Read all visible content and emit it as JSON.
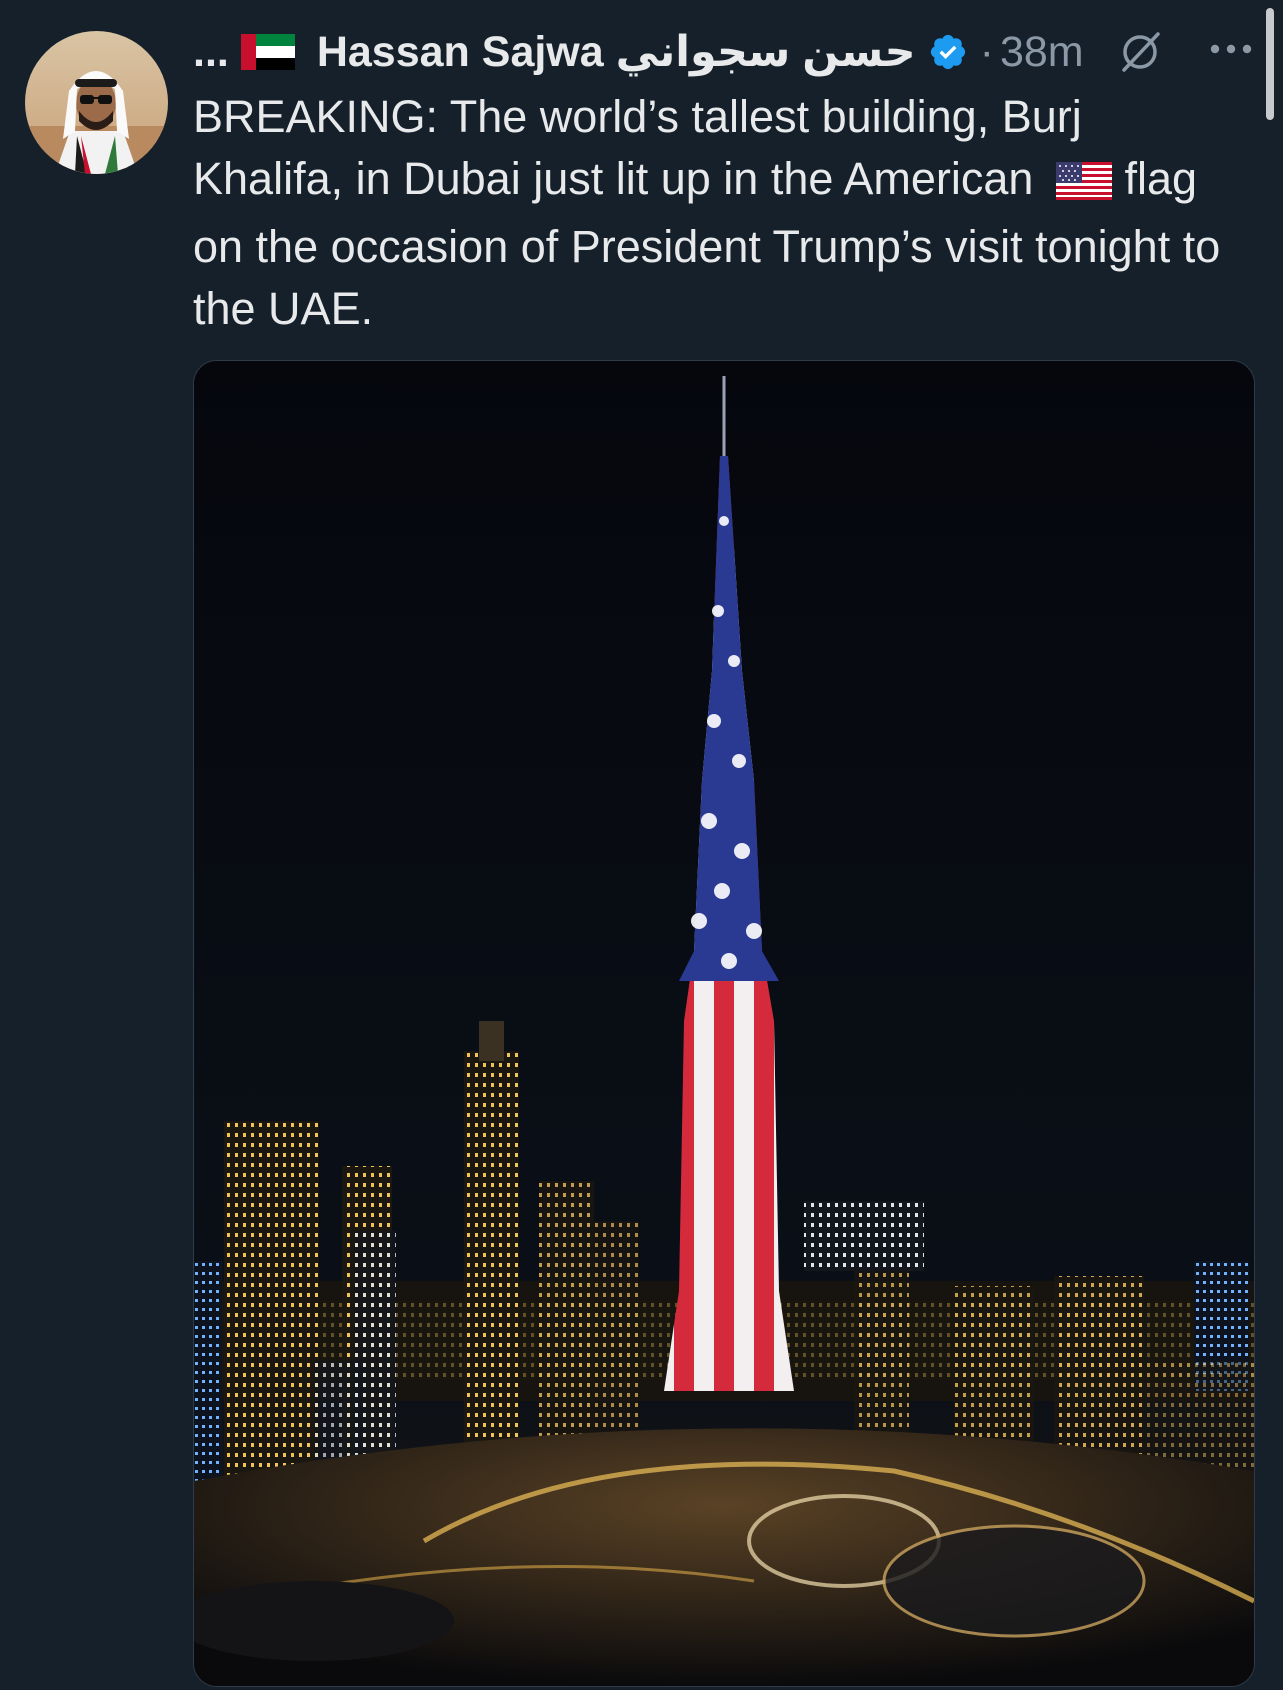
{
  "author": {
    "truncated_prefix": "...",
    "display_name": "Hassan Sajwa حسن سجواني",
    "verified": true,
    "flag_icon": "uae-flag-icon"
  },
  "meta": {
    "separator": "·",
    "time": "38m"
  },
  "tweet": {
    "text_before_flag": "BREAKING: The world’s tallest building, Burj Khalifa, in Dubai just lit up in the American",
    "text_after_flag": "flag on the occasion of President Trump’s visit tonight to the UAE.",
    "inline_icon": "us-flag-icon"
  },
  "icons": {
    "grok": "grok-icon",
    "more": "more-icon",
    "verified": "verified-badge-icon"
  },
  "colors": {
    "background": "#15202b",
    "text": "#e7e9ea",
    "secondary_text": "#8b98a5",
    "verified_blue": "#1d9bf0"
  }
}
